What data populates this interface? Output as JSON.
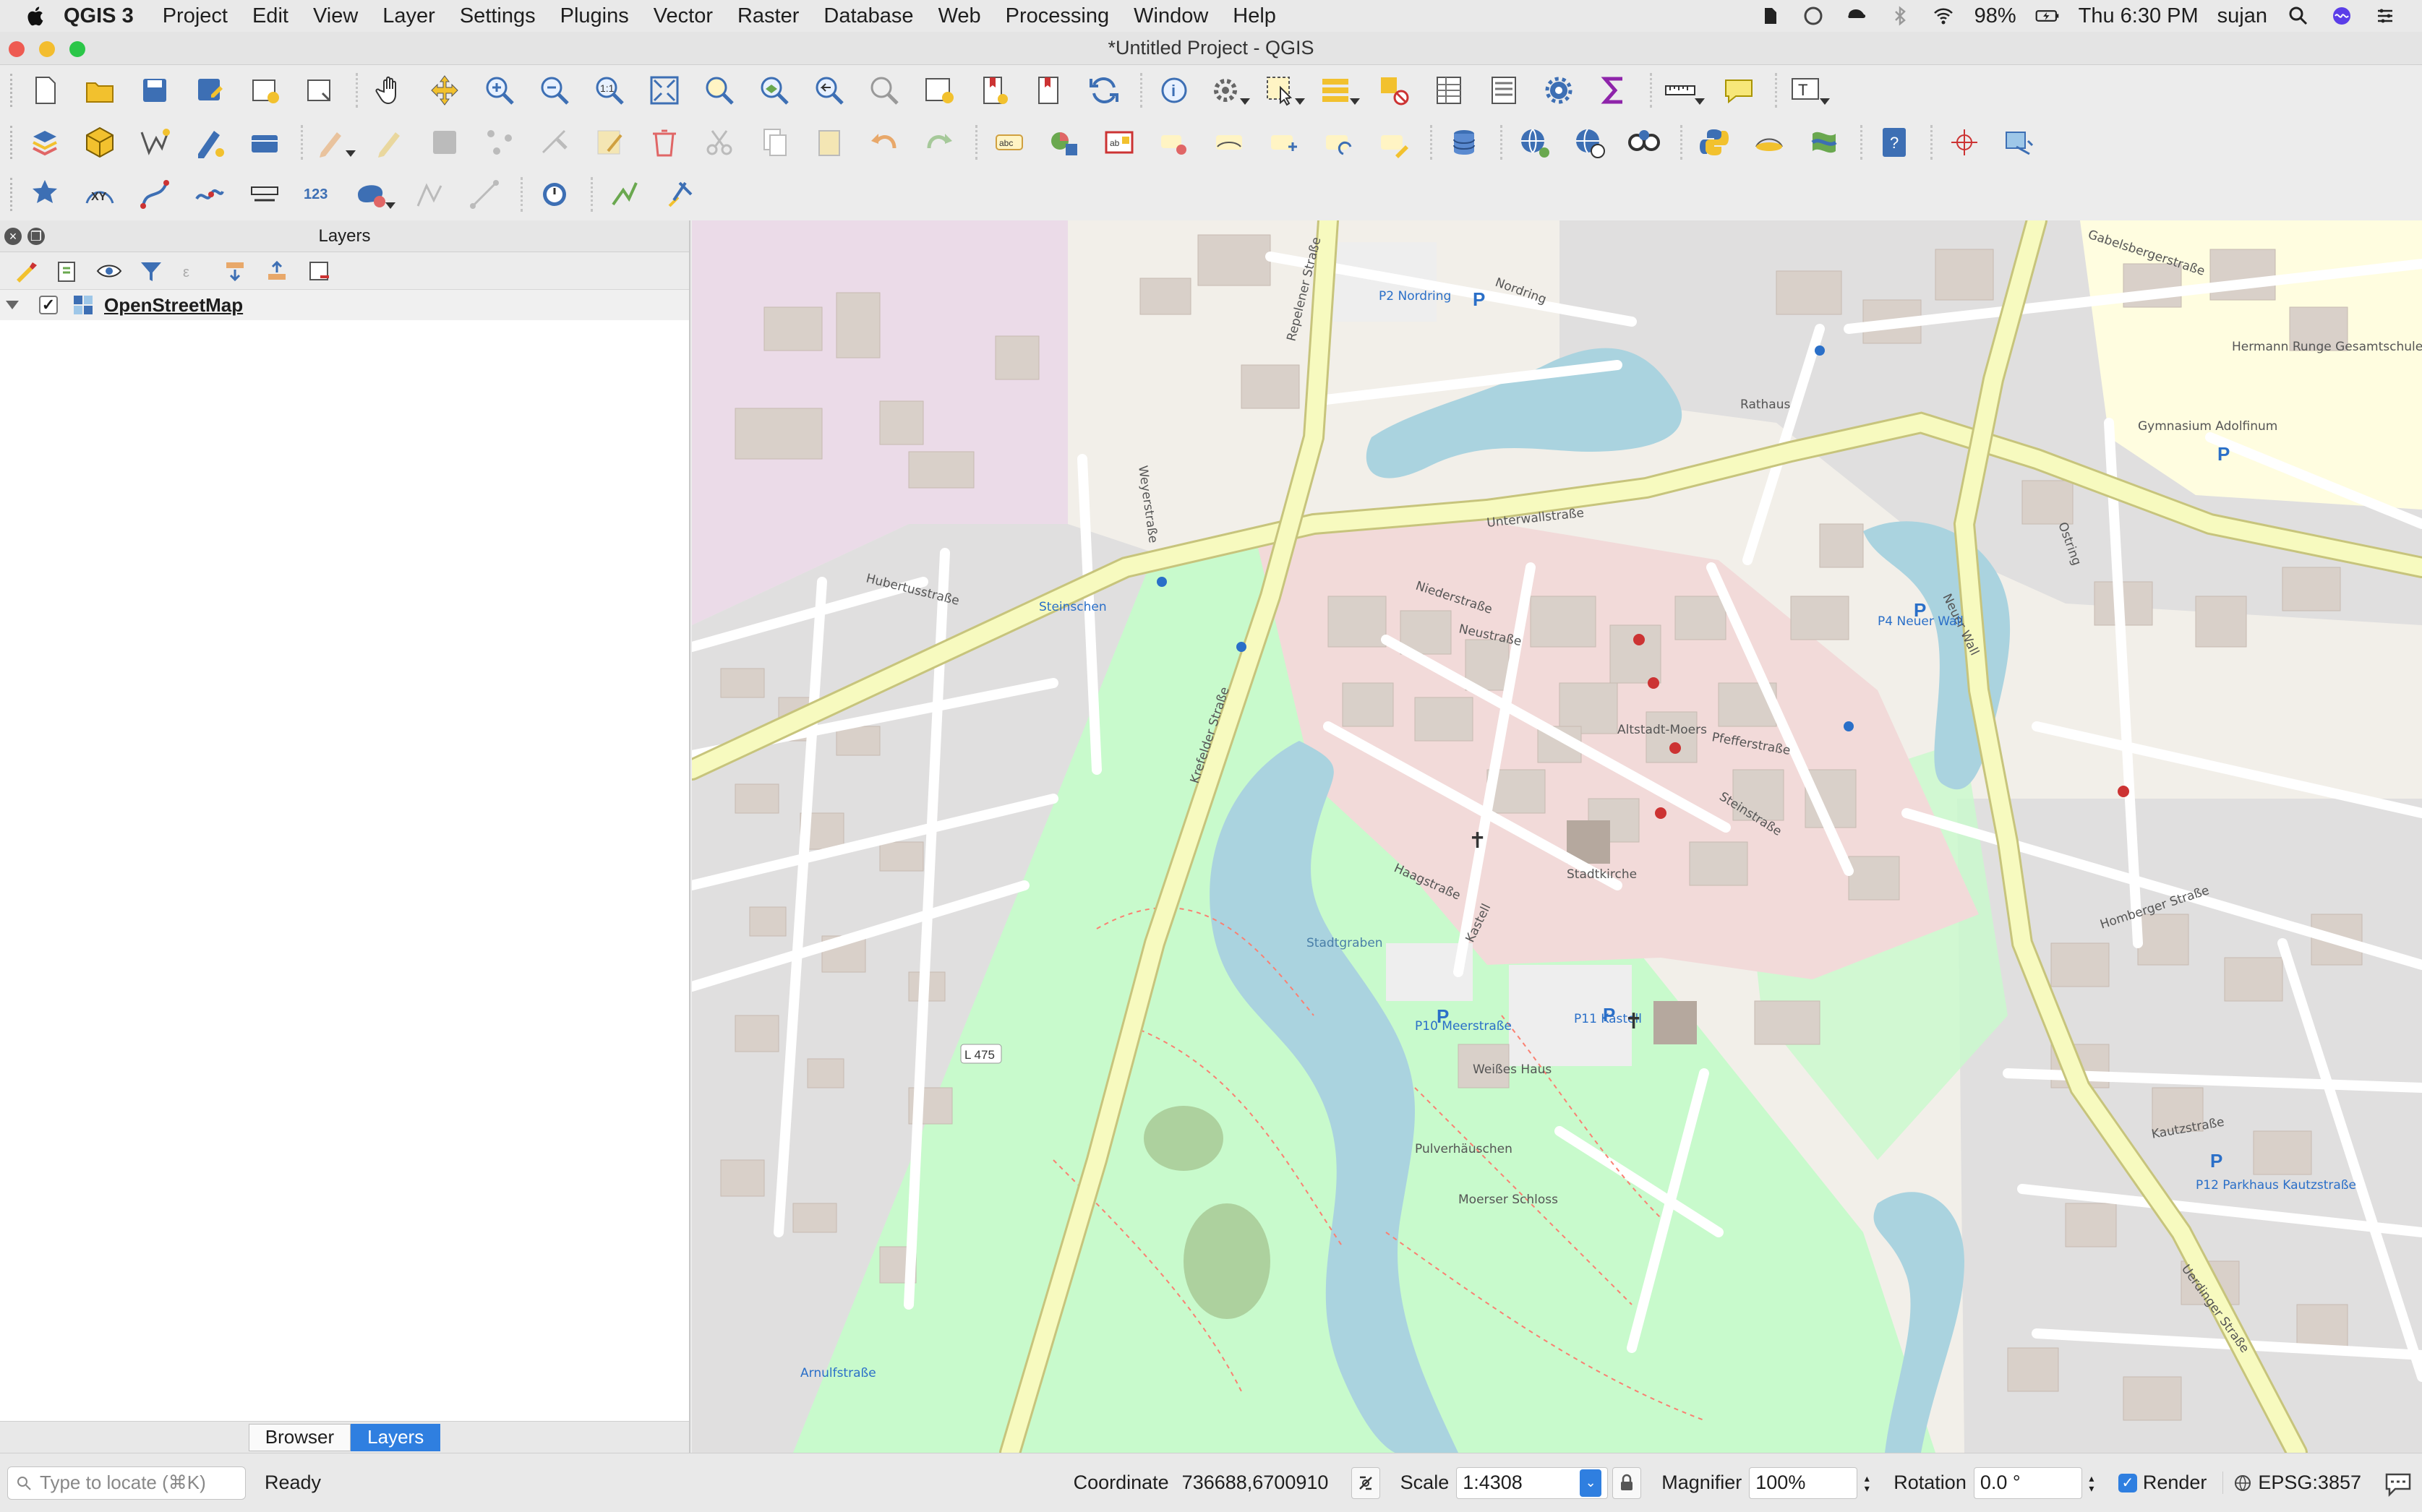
{
  "menubar": {
    "app": "QGIS 3",
    "items": [
      "Project",
      "Edit",
      "View",
      "Layer",
      "Settings",
      "Plugins",
      "Vector",
      "Raster",
      "Database",
      "Web",
      "Processing",
      "Window",
      "Help"
    ],
    "battery": "98%",
    "clock": "Thu 6:30 PM",
    "user": "sujan"
  },
  "window": {
    "title": "*Untitled Project - QGIS"
  },
  "layers_panel": {
    "title": "Layers",
    "layers": [
      {
        "name": "OpenStreetMap",
        "checked": true
      }
    ],
    "tabs": [
      "Browser",
      "Layers"
    ],
    "active_tab": "Layers"
  },
  "map": {
    "labels": {
      "repelener": "Repelener Straße",
      "nordring": "Nordring",
      "p2": "P2 Nordring",
      "unterwall": "Unterwallstraße",
      "gabelsberger": "Gabelsbergerstraße",
      "weyer": "Weyerstraße",
      "krefelder": "Krefelder Straße",
      "hubertus": "Hubertusstraße",
      "niederstr": "Niederstraße",
      "neustrasse": "Neustraße",
      "haagstrasse": "Haagstraße",
      "altstadt": "Altstadt-Moers",
      "pfeffer": "Pfefferstraße",
      "steinstr": "Steinstraße",
      "neuer_wall": "Neuer Wall",
      "homberger": "Homberger Straße",
      "stadtgraben": "Stadtgraben",
      "ostring": "Ostring",
      "kastell": "Kastell",
      "stadtkirche": "Stadtkirche",
      "rathaus": "Rathaus",
      "moerser_schloss": "Moerser Schloss",
      "l475": "L 475",
      "uerdinger": "Uerdinger Straße",
      "kautz": "Kautzstraße",
      "amulf": "Arnulfstraße",
      "hermann": "Hermann Runge Gesamtschule",
      "gymnasium": "Gymnasium Adolfinum",
      "p10": "P10 Meerstraße",
      "p11": "P11 Kastell",
      "p4": "P4 Neuer Wall",
      "p12": "P12 Parkhaus Kautzstraße",
      "pulverhaeuschen": "Pulverhäuschen",
      "weisses_haus": "Weißes Haus",
      "steinschen": "Steinschen"
    }
  },
  "status": {
    "locate_placeholder": "Type to locate (⌘K)",
    "ready": "Ready",
    "coordinate_label": "Coordinate",
    "coordinate": "736688,6700910",
    "scale_label": "Scale",
    "scale": "1:4308",
    "magnifier_label": "Magnifier",
    "magnifier": "100%",
    "rotation_label": "Rotation",
    "rotation": "0.0 °",
    "render_label": "Render",
    "crs": "EPSG:3857"
  },
  "colors": {
    "accent": "#2f7fe0",
    "park": "#c8facc",
    "water": "#aad3df",
    "road_major": "#f7fabf",
    "pedestrian": "#f2dad9"
  }
}
